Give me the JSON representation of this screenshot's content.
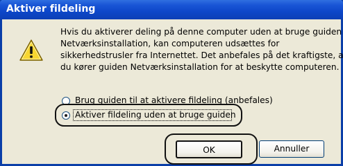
{
  "window": {
    "title": "Aktiver fildeling"
  },
  "message": {
    "icon": "warning-icon",
    "lines": [
      "Hvis du aktiverer deling på denne computer uden at bruge guiden",
      "Netværksinstallation, kan computeren udsættes for",
      "sikkerhedstrusler fra Internettet. Det anbefales på det kraftigste, at",
      "du kører guiden Netværksinstallation for at beskytte computeren."
    ]
  },
  "options": [
    {
      "label": "Brug guiden til at aktivere fildeling (anbefales)",
      "selected": false
    },
    {
      "label": "Aktiver fildeling uden at bruge guiden",
      "selected": true
    }
  ],
  "buttons": {
    "ok": "OK",
    "cancel": "Annuller"
  },
  "colors": {
    "titlebar": "#0d47c9",
    "dialog_background": "#ece9d8",
    "warning_fill": "#f7d631",
    "highlight_ring": "#111111"
  }
}
